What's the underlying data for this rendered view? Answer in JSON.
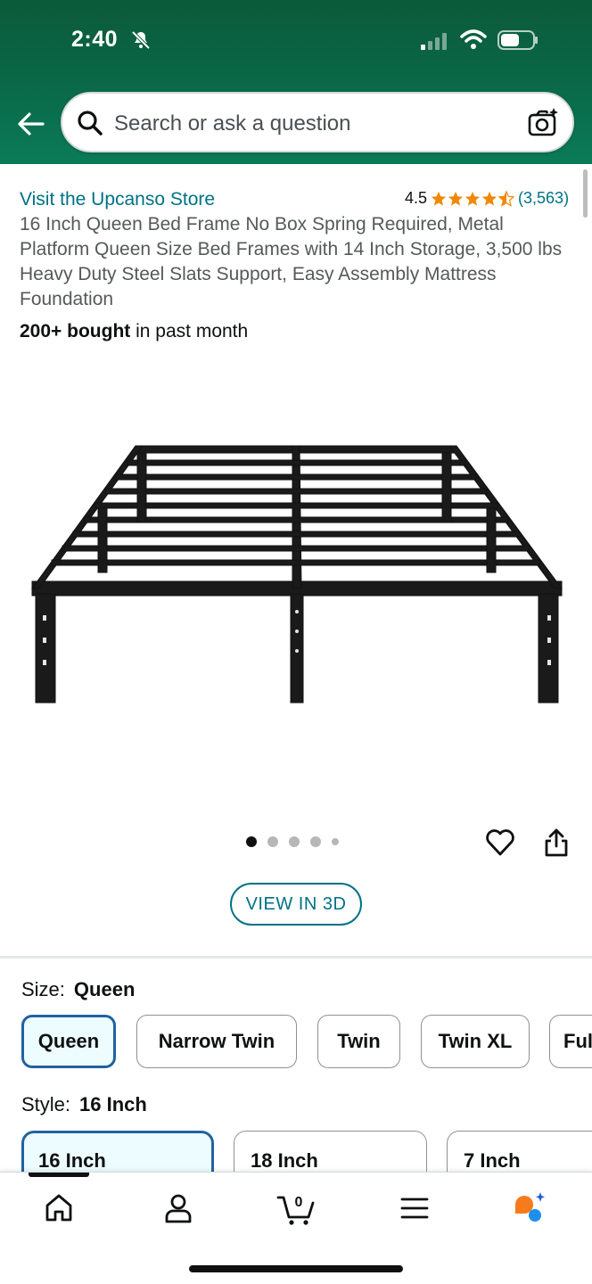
{
  "status_bar": {
    "time": "2:40"
  },
  "search": {
    "placeholder": "Search or ask a question"
  },
  "product": {
    "store_link": "Visit the Upcanso Store",
    "rating_value": "4.5",
    "rating_count": "(3,563)",
    "title": "16 Inch Queen Bed Frame No Box Spring Required, Metal Platform Queen Size Bed Frames with 14 Inch Storage, 3,500 lbs Heavy Duty Steel Slats Support, Easy Assembly Mattress Foundation",
    "bought_bold": "200+ bought",
    "bought_rest": " in past month",
    "image_count": 5,
    "active_image": 1
  },
  "actions": {
    "view_3d": "VIEW IN 3D"
  },
  "size": {
    "label": "Size:",
    "selected": "Queen",
    "options": [
      "Queen",
      "Narrow Twin",
      "Twin",
      "Twin XL",
      "Full"
    ]
  },
  "style": {
    "label": "Style:",
    "selected": "16 Inch",
    "options": [
      "16 Inch",
      "18 Inch",
      "7 Inch"
    ]
  },
  "bottom_nav": {
    "items": [
      "home-icon",
      "account-icon",
      "cart-icon",
      "menu-icon",
      "rufus-assistant-icon"
    ],
    "cart_count": "0"
  },
  "colors": {
    "header": "#0b6b4a",
    "link": "#007185",
    "star": "#f08804",
    "selected_border": "#2162a1"
  }
}
